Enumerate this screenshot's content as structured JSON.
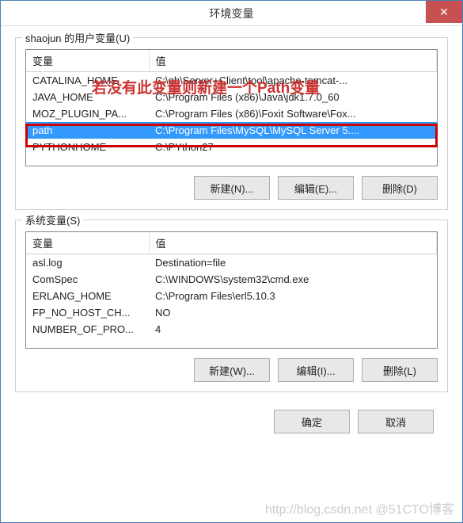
{
  "title": "环境变量",
  "close_symbol": "✕",
  "user_vars": {
    "label": "shaojun 的用户变量(U)",
    "headers": {
      "var": "变量",
      "val": "值"
    },
    "rows": [
      {
        "var": "CATALINA_HOME",
        "val": "C:\\gh\\Server+Client\\tool\\apache-tomcat-...",
        "selected": false
      },
      {
        "var": "JAVA_HOME",
        "val": "C:\\Program Files (x86)\\Java\\jdk1.7.0_60",
        "selected": false
      },
      {
        "var": "MOZ_PLUGIN_PA...",
        "val": "C:\\Program Files (x86)\\Foxit Software\\Fox...",
        "selected": false
      },
      {
        "var": "path",
        "val": "C:\\Program Files\\MySQL\\MySQL Server 5....",
        "selected": true
      },
      {
        "var": "PYTHONHOME",
        "val": "C:\\PYthon27",
        "selected": false
      }
    ],
    "buttons": {
      "new": "新建(N)...",
      "edit": "编辑(E)...",
      "delete": "删除(D)"
    }
  },
  "system_vars": {
    "label": "系统变量(S)",
    "headers": {
      "var": "变量",
      "val": "值"
    },
    "rows": [
      {
        "var": "asl.log",
        "val": "Destination=file"
      },
      {
        "var": "ComSpec",
        "val": "C:\\WINDOWS\\system32\\cmd.exe"
      },
      {
        "var": "ERLANG_HOME",
        "val": "C:\\Program Files\\erl5.10.3"
      },
      {
        "var": "FP_NO_HOST_CH...",
        "val": "NO"
      },
      {
        "var": "NUMBER_OF_PRO...",
        "val": "4"
      }
    ],
    "buttons": {
      "new": "新建(W)...",
      "edit": "编辑(I)...",
      "delete": "删除(L)"
    }
  },
  "dialog_buttons": {
    "ok": "确定",
    "cancel": "取消"
  },
  "annotation_text": "若没有此变量则新建一个Path变量",
  "watermark": "http://blog.csdn.net @51CTO博客"
}
